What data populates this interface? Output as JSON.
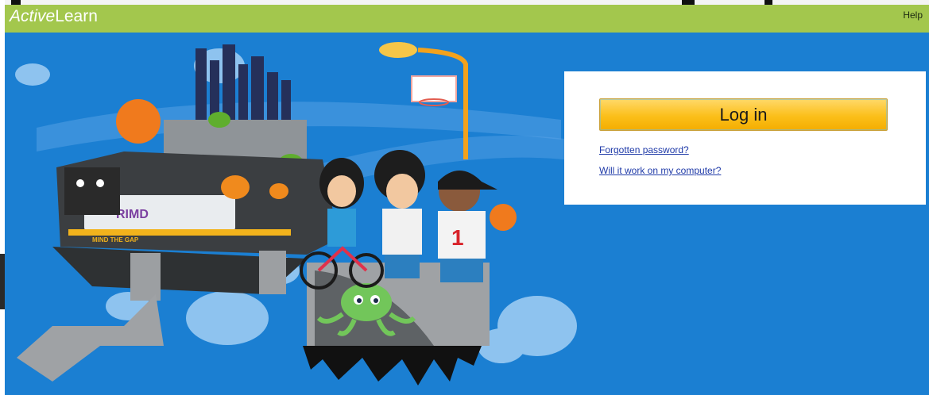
{
  "header": {
    "logo_italic": "Active",
    "logo_rest": "Learn",
    "help_label": "Help"
  },
  "login": {
    "button_label": "Log in",
    "forgot_link": "Forgotten password?",
    "compat_link": "Will it work on my computer?"
  },
  "illustration": {
    "train_sign": "MIND THE GAP",
    "train_graffiti": "RIMD",
    "jersey_number": "1"
  },
  "colors": {
    "header_bg": "#a3c74d",
    "scene_bg": "#1b7fd2",
    "button_yellow": "#fbbf1a",
    "link_blue": "#1f3aa8"
  }
}
